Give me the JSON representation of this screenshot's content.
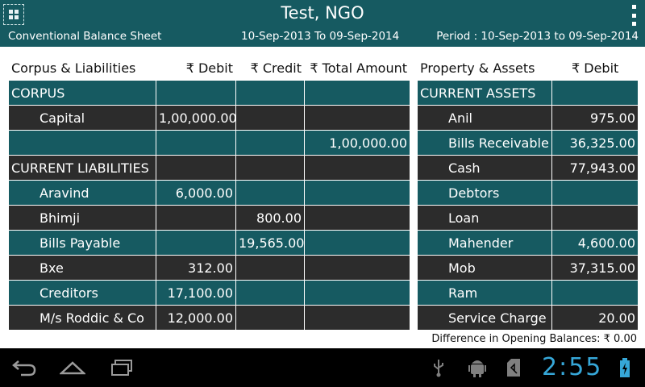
{
  "header": {
    "title": "Test, NGO",
    "report_name": "Conventional Balance Sheet",
    "date_range": "10-Sep-2013 To 09-Sep-2014",
    "period": "Period : 10-Sep-2013 to 09-Sep-2014",
    "menu_icon": "grid-menu-icon",
    "overflow_icon": "overflow-menu-icon"
  },
  "liabilities": {
    "columns": [
      "Corpus & Liabilities",
      "₹ Debit",
      "₹ Credit",
      "₹ Total Amount"
    ],
    "rows": [
      {
        "label": "CORPUS",
        "debit": "",
        "credit": "",
        "total": ""
      },
      {
        "label": "Capital",
        "debit": "1,00,000.00",
        "credit": "",
        "total": ""
      },
      {
        "label": "",
        "debit": "",
        "credit": "",
        "total": "1,00,000.00"
      },
      {
        "label": "CURRENT LIABILITIES",
        "debit": "",
        "credit": "",
        "total": ""
      },
      {
        "label": "Aravind",
        "debit": "6,000.00",
        "credit": "",
        "total": ""
      },
      {
        "label": "Bhimji",
        "debit": "",
        "credit": "800.00",
        "total": ""
      },
      {
        "label": "Bills Payable",
        "debit": "",
        "credit": "19,565.00",
        "total": ""
      },
      {
        "label": "Bxe",
        "debit": "312.00",
        "credit": "",
        "total": ""
      },
      {
        "label": "Creditors",
        "debit": "17,100.00",
        "credit": "",
        "total": ""
      },
      {
        "label": "M/s Roddic & Co",
        "debit": "12,000.00",
        "credit": "",
        "total": ""
      }
    ]
  },
  "assets": {
    "columns": [
      "Property & Assets",
      "₹ Debit"
    ],
    "rows": [
      {
        "label": "CURRENT ASSETS",
        "debit": ""
      },
      {
        "label": "Anil",
        "debit": "975.00"
      },
      {
        "label": "Bills Receivable",
        "debit": "36,325.00"
      },
      {
        "label": "Cash",
        "debit": "77,943.00"
      },
      {
        "label": "Debtors",
        "debit": ""
      },
      {
        "label": "Loan",
        "debit": ""
      },
      {
        "label": "Mahender",
        "debit": "4,600.00"
      },
      {
        "label": "Mob",
        "debit": "37,315.00"
      },
      {
        "label": "Ram",
        "debit": ""
      },
      {
        "label": "Service Charge",
        "debit": "20.00"
      }
    ]
  },
  "footer": {
    "difference_text": "Difference in Opening Balances: ₹ 0.00"
  },
  "system_bar": {
    "clock": "2:55",
    "icons": [
      "back-icon",
      "home-icon",
      "recent-apps-icon",
      "usb-icon",
      "android-debug-icon",
      "sd-card-icon",
      "battery-charging-icon"
    ]
  },
  "colors": {
    "teal": "#165a61",
    "dark_row": "#2c2c2c",
    "clock": "#36a7d8"
  }
}
